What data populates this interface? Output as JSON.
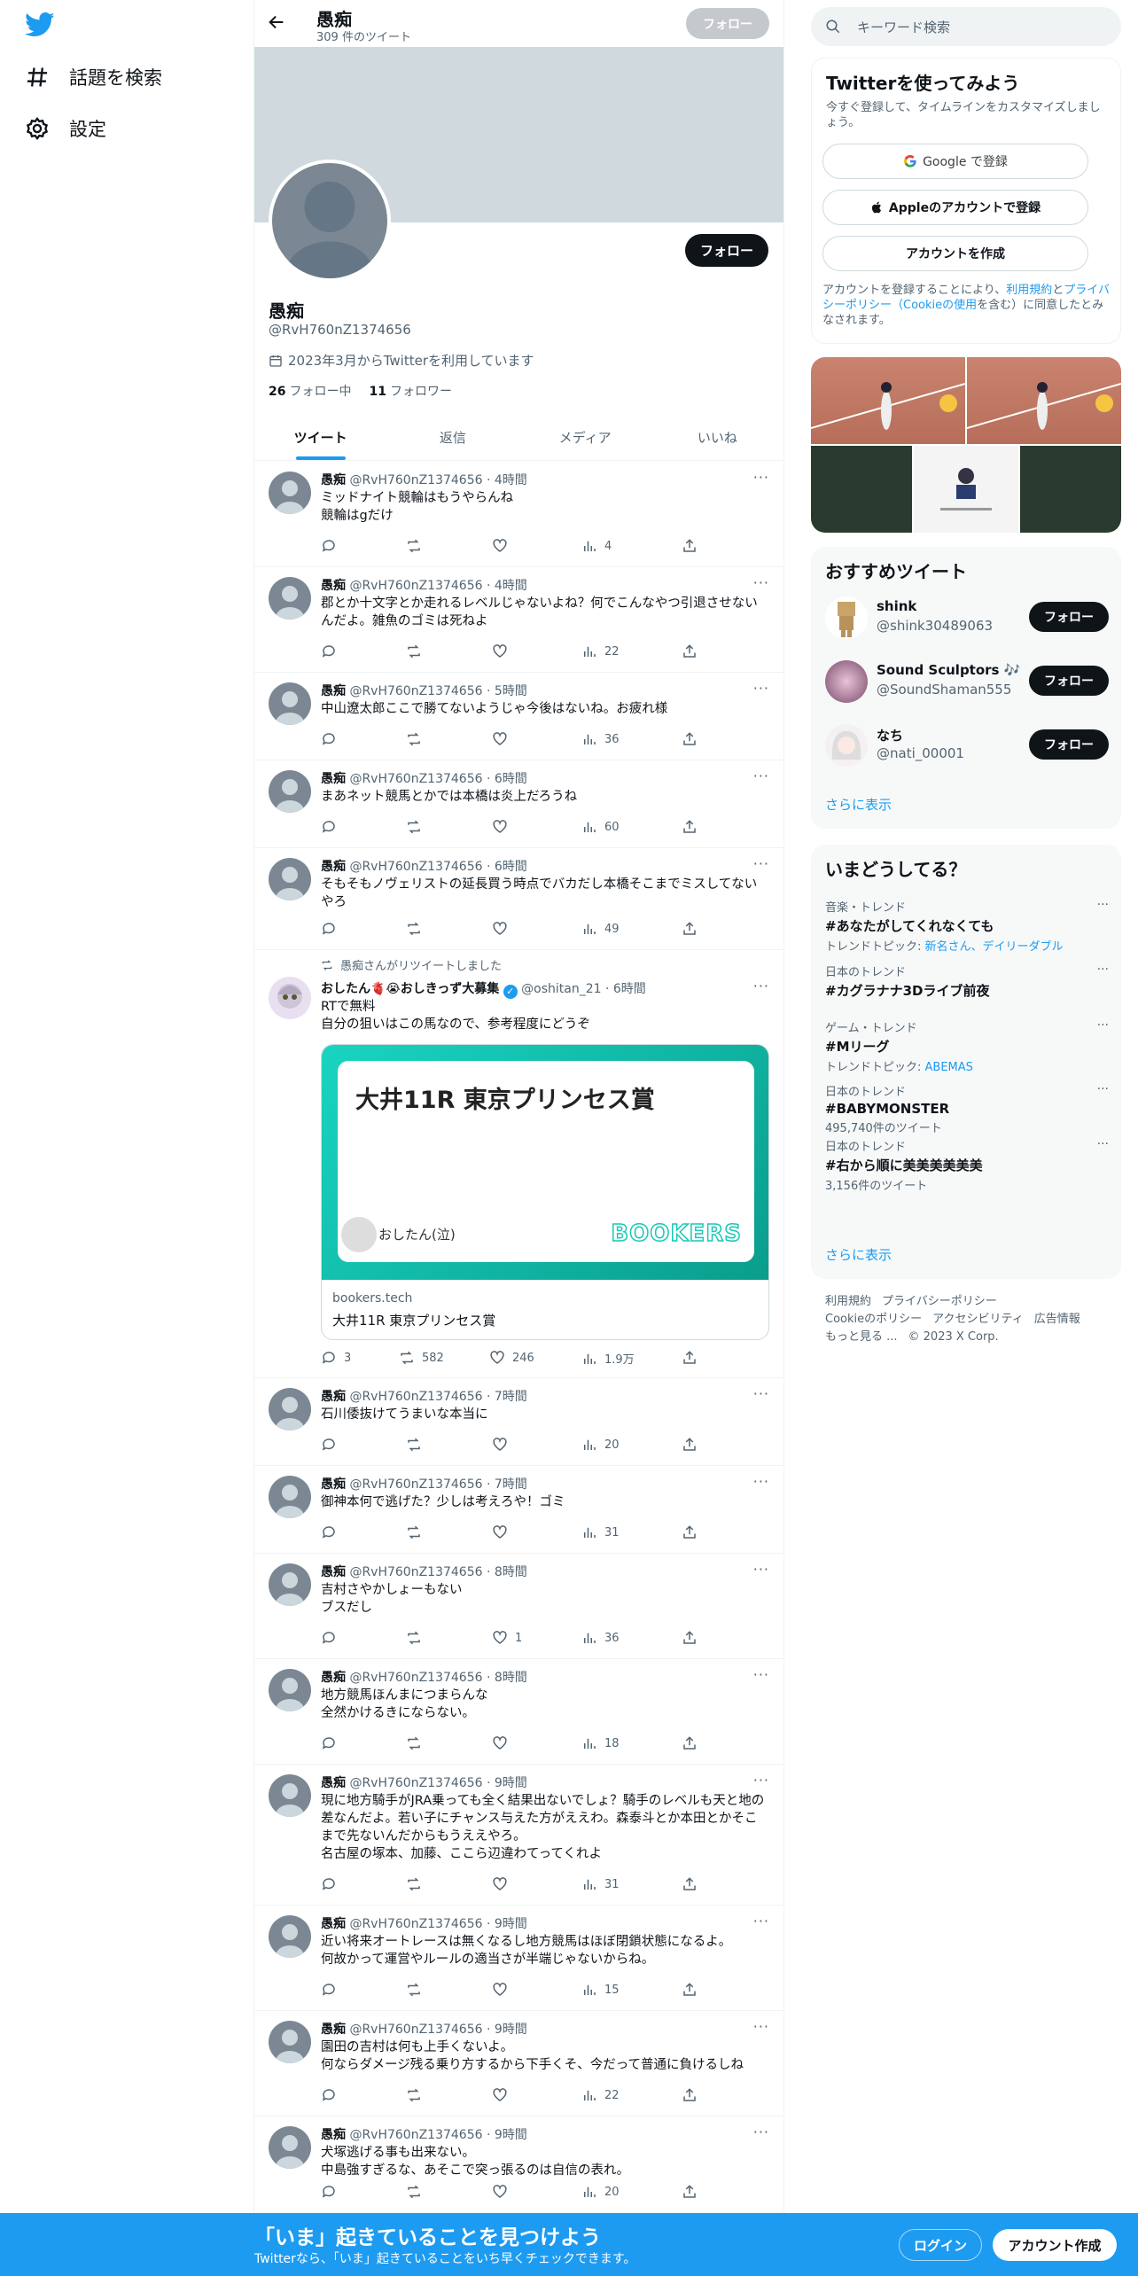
{
  "nav": {
    "explore_label": "話題を検索",
    "settings_label": "設定"
  },
  "header": {
    "name": "愚痴",
    "tweet_count": "309 件のツイート",
    "follow_label": "フォロー"
  },
  "profile": {
    "name": "愚痴",
    "handle": "@RvH760nZ1374656",
    "joined": "2023年3月からTwitterを利用しています",
    "following_count": "26",
    "following_label": "フォロー中",
    "followers_count": "11",
    "followers_label": "フォロワー",
    "follow_label": "フォロー"
  },
  "tabs": [
    {
      "label": "ツイート"
    },
    {
      "label": "返信"
    },
    {
      "label": "メディア"
    },
    {
      "label": "いいね"
    }
  ],
  "tweets": [
    {
      "name": "愚痴",
      "handle": "@RvH760nZ1374656",
      "time": "4時間",
      "text": "ミッドナイト競輪はもうやらんね\n競輪はgだけ",
      "reply": "",
      "retweet": "",
      "like": "",
      "views": "4"
    },
    {
      "name": "愚痴",
      "handle": "@RvH760nZ1374656",
      "time": "4時間",
      "text": "郡とか十文字とか走れるレベルじゃないよね？何でこんなやつ引退させないんだよ。雑魚のゴミは死ねよ",
      "reply": "",
      "retweet": "",
      "like": "",
      "views": "22"
    },
    {
      "name": "愚痴",
      "handle": "@RvH760nZ1374656",
      "time": "5時間",
      "text": "中山遼太郎ここで勝てないようじゃ今後はないね。お疲れ様",
      "reply": "",
      "retweet": "",
      "like": "",
      "views": "36"
    },
    {
      "name": "愚痴",
      "handle": "@RvH760nZ1374656",
      "time": "6時間",
      "text": "まあネット競馬とかでは本橋は炎上だろうね",
      "reply": "",
      "retweet": "",
      "like": "",
      "views": "60"
    },
    {
      "name": "愚痴",
      "handle": "@RvH760nZ1374656",
      "time": "6時間",
      "text": "そもそもノヴェリストの延長買う時点でバカだし本橋そこまでミスしてないやろ",
      "reply": "",
      "retweet": "",
      "like": "",
      "views": "49"
    },
    {
      "name": "愚痴",
      "handle": "@RvH760nZ1374656",
      "time": "7時間",
      "text": "石川倭抜けてうまいな本当に",
      "reply": "",
      "retweet": "",
      "like": "",
      "views": "20"
    },
    {
      "name": "愚痴",
      "handle": "@RvH760nZ1374656",
      "time": "7時間",
      "text": "御神本何で逃げた？少しは考えろや！ゴミ",
      "reply": "",
      "retweet": "",
      "like": "",
      "views": "31"
    },
    {
      "name": "愚痴",
      "handle": "@RvH760nZ1374656",
      "time": "8時間",
      "text": "吉村さやかしょーもない\nブスだし",
      "reply": "",
      "retweet": "",
      "like": "1",
      "views": "36"
    },
    {
      "name": "愚痴",
      "handle": "@RvH760nZ1374656",
      "time": "8時間",
      "text": "地方競馬ほんまにつまらんな\n全然かけるきにならない。",
      "reply": "",
      "retweet": "",
      "like": "",
      "views": "18"
    },
    {
      "name": "愚痴",
      "handle": "@RvH760nZ1374656",
      "time": "9時間",
      "text": "現に地方騎手がJRA乗っても全く結果出ないでしょ？騎手のレベルも天と地の差なんだよ。若い子にチャンス与えた方がええわ。森泰斗とか本田とかそこまで先ないんだからもうええやろ。\n名古屋の塚本、加藤、ここら辺違わてってくれよ",
      "reply": "",
      "retweet": "",
      "like": "",
      "views": "31"
    },
    {
      "name": "愚痴",
      "handle": "@RvH760nZ1374656",
      "time": "9時間",
      "text": "近い将来オートレースは無くなるし地方競馬はほぼ閉鎖状態になるよ。\n何故かって運営やルールの適当さが半端じゃないからね。",
      "reply": "",
      "retweet": "",
      "like": "",
      "views": "15"
    },
    {
      "name": "愚痴",
      "handle": "@RvH760nZ1374656",
      "time": "9時間",
      "text": "園田の吉村は何も上手くないよ。\n何ならダメージ残る乗り方するから下手くそ、今だって普通に負けるしね",
      "reply": "",
      "retweet": "",
      "like": "",
      "views": "22"
    },
    {
      "name": "愚痴",
      "handle": "@RvH760nZ1374656",
      "time": "9時間",
      "text": "犬塚逃げる事も出来ない。\n中島強すぎるな、あそこで突っ張るのは自信の表れ。",
      "reply": "",
      "retweet": "",
      "like": "",
      "views": "20"
    }
  ],
  "retweet": {
    "label": "愚痴さんがリツイートしました",
    "name": "おしたん🫀😭おしきっず大募集",
    "handle": "@oshitan_21",
    "time": "6時間",
    "text": "RTで無料\n自分の狙いはこの馬なので、参考程度にどうぞ",
    "card_title": "大井11R 東京プリンセス賞",
    "card_author": "おしたん(泣)",
    "card_logo": "BOOKERS",
    "card_domain": "bookers.tech",
    "card_caption": "大井11R 東京プリンセス賞",
    "reply": "3",
    "retweet": "582",
    "like": "246",
    "views": "1.9万"
  },
  "search": {
    "placeholder": "キーワード検索"
  },
  "signup": {
    "title": "Twitterを使ってみよう",
    "subtitle": "今すぐ登録して、タイムラインをカスタマイズしましょう。",
    "google_label": "Google で登録",
    "apple_label": "Appleのアカウントで登録",
    "create_label": "アカウントを作成",
    "legal_1": "アカウントを登録することにより、",
    "legal_link_1": "利用規約",
    "legal_2": "と",
    "legal_link_2": "プライバシーポリシー（Cookieの使用",
    "legal_3": "を含む）に同意したとみなされます。"
  },
  "recommend": {
    "title": "おすすめツイート",
    "users": [
      {
        "name": "shink",
        "handle": "@shink30489063",
        "follow": "フォロー"
      },
      {
        "name": "Sound Sculptors 🎶",
        "handle": "@SoundShaman555",
        "follow": "フォロー"
      },
      {
        "name": "なち",
        "handle": "@nati_00001",
        "follow": "フォロー"
      }
    ],
    "more": "さらに表示"
  },
  "trends": {
    "title": "いまどうしてる？",
    "items": [
      {
        "meta": "音楽・トレンド",
        "name": "#あなたがしてくれなくても",
        "sub_prefix": "トレンドトピック: ",
        "sub_link": "新名さん、デイリーダブル",
        "sub": ""
      },
      {
        "meta": "日本のトレンド",
        "name": "#カグラナナ3Dライブ前夜",
        "sub_prefix": "",
        "sub_link": "",
        "sub": ""
      },
      {
        "meta": "ゲーム・トレンド",
        "name": "#Mリーグ",
        "sub_prefix": "トレンドトピック: ",
        "sub_link": "ABEMAS",
        "sub": ""
      },
      {
        "meta": "日本のトレンド",
        "name": "#BABYMONSTER",
        "sub_prefix": "",
        "sub_link": "",
        "sub": "495,740件のツイート"
      },
      {
        "meta": "日本のトレンド",
        "name": "#右から順に美美美美美美",
        "sub_prefix": "",
        "sub_link": "",
        "sub": "3,156件のツイート"
      }
    ],
    "more": "さらに表示"
  },
  "footer": {
    "terms": "利用規約",
    "privacy": "プライバシーポリシー",
    "cookie": "Cookieのポリシー",
    "accessibility": "アクセシビリティ",
    "ads": "広告情報",
    "more": "もっと見る ...",
    "copyright": "© 2023 X Corp."
  },
  "bottom": {
    "title": "「いま」起きていることを見つけよう",
    "subtitle": "Twitterなら、「いま」起きていることをいち早くチェックできます。",
    "login": "ログイン",
    "signup": "アカウント作成"
  }
}
